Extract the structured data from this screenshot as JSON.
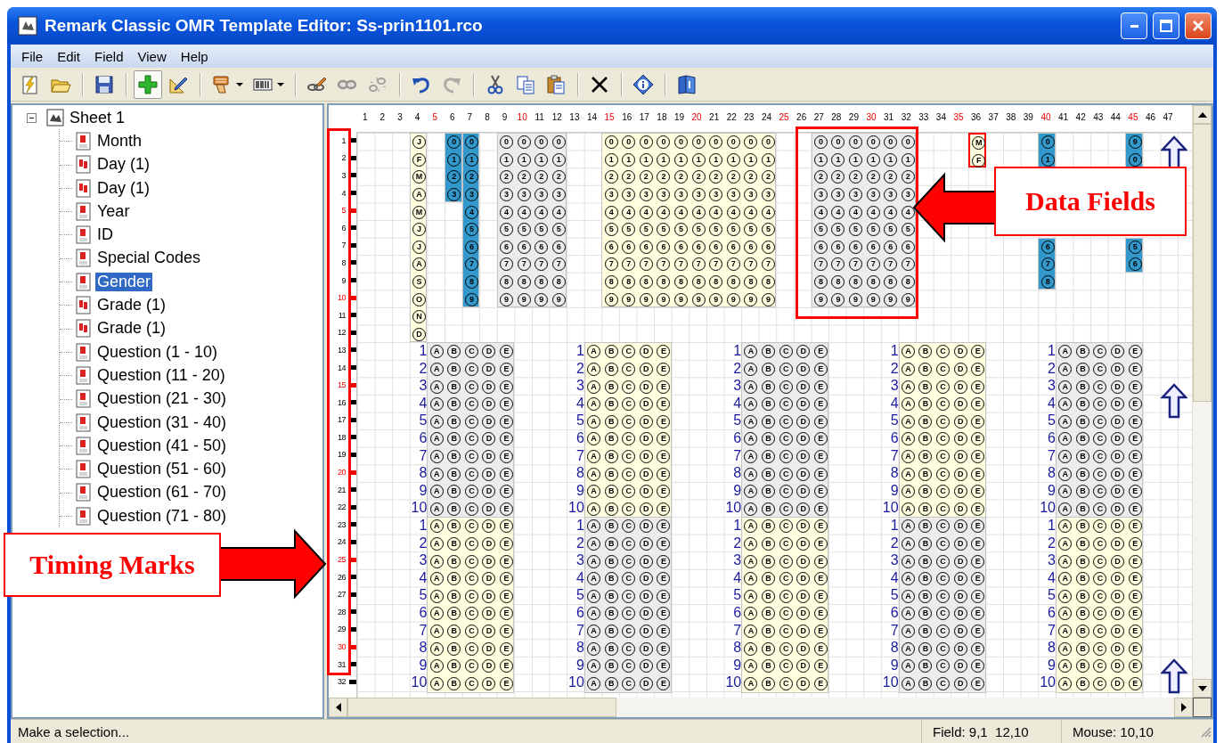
{
  "window": {
    "title": "Remark Classic OMR Template Editor: Ss-prin1101.rco"
  },
  "menu": [
    {
      "label": "File"
    },
    {
      "label": "Edit"
    },
    {
      "label": "Field"
    },
    {
      "label": "View"
    },
    {
      "label": "Help"
    }
  ],
  "toolbar": [
    {
      "kind": "new",
      "pressed": false,
      "disabled": false,
      "dropdown": false
    },
    {
      "kind": "open",
      "pressed": false,
      "disabled": false,
      "dropdown": false
    },
    {
      "kind": "separator"
    },
    {
      "kind": "save",
      "pressed": false,
      "disabled": false,
      "dropdown": false
    },
    {
      "kind": "separator"
    },
    {
      "kind": "add",
      "pressed": true,
      "disabled": false,
      "dropdown": false
    },
    {
      "kind": "edit",
      "pressed": false,
      "disabled": false,
      "dropdown": false
    },
    {
      "kind": "separator"
    },
    {
      "kind": "brush",
      "pressed": false,
      "disabled": false,
      "dropdown": true
    },
    {
      "kind": "barcode",
      "pressed": false,
      "disabled": false,
      "dropdown": true
    },
    {
      "kind": "separator"
    },
    {
      "kind": "linkedit",
      "pressed": false,
      "disabled": false,
      "dropdown": false
    },
    {
      "kind": "link",
      "pressed": false,
      "disabled": true,
      "dropdown": false
    },
    {
      "kind": "unlink",
      "pressed": false,
      "disabled": true,
      "dropdown": false
    },
    {
      "kind": "separator"
    },
    {
      "kind": "undo",
      "pressed": false,
      "disabled": false,
      "dropdown": false
    },
    {
      "kind": "redo",
      "pressed": false,
      "disabled": true,
      "dropdown": false
    },
    {
      "kind": "separator"
    },
    {
      "kind": "cut",
      "pressed": false,
      "disabled": false,
      "dropdown": false
    },
    {
      "kind": "copy",
      "pressed": false,
      "disabled": false,
      "dropdown": false
    },
    {
      "kind": "paste",
      "pressed": false,
      "disabled": false,
      "dropdown": false
    },
    {
      "kind": "separator"
    },
    {
      "kind": "delete",
      "pressed": false,
      "disabled": false,
      "dropdown": false
    },
    {
      "kind": "separator"
    },
    {
      "kind": "info",
      "pressed": false,
      "disabled": false,
      "dropdown": false
    },
    {
      "kind": "separator"
    },
    {
      "kind": "book",
      "pressed": false,
      "disabled": false,
      "dropdown": false
    }
  ],
  "tree": {
    "label": "Sheet 1",
    "expanded": true,
    "children": [
      {
        "label": "Month",
        "kind": "single",
        "selected": false
      },
      {
        "label": "Day (1)",
        "kind": "multi",
        "selected": false
      },
      {
        "label": "Day (1)",
        "kind": "multi",
        "selected": false
      },
      {
        "label": "Year",
        "kind": "single",
        "selected": false
      },
      {
        "label": "ID",
        "kind": "single",
        "selected": false
      },
      {
        "label": "Special Codes",
        "kind": "single",
        "selected": false
      },
      {
        "label": "Gender",
        "kind": "single",
        "selected": true
      },
      {
        "label": "Grade (1)",
        "kind": "multi",
        "selected": false
      },
      {
        "label": "Grade (1)",
        "kind": "multi",
        "selected": false
      },
      {
        "label": "Question (1 - 10)",
        "kind": "single",
        "selected": false
      },
      {
        "label": "Question (11 - 20)",
        "kind": "single",
        "selected": false
      },
      {
        "label": "Question (21 - 30)",
        "kind": "single",
        "selected": false
      },
      {
        "label": "Question (31 - 40)",
        "kind": "single",
        "selected": false
      },
      {
        "label": "Question (41 - 50)",
        "kind": "single",
        "selected": false
      },
      {
        "label": "Question (51 - 60)",
        "kind": "single",
        "selected": false
      },
      {
        "label": "Question (61 - 70)",
        "kind": "single",
        "selected": false
      },
      {
        "label": "Question (71 - 80)",
        "kind": "single",
        "selected": false
      }
    ]
  },
  "canvas": {
    "column_headers": [
      {
        "label": "1",
        "accent": false
      },
      {
        "label": "2",
        "accent": false
      },
      {
        "label": "3",
        "accent": false
      },
      {
        "label": "4",
        "accent": false
      },
      {
        "label": "5",
        "accent": true
      },
      {
        "label": "6",
        "accent": false
      },
      {
        "label": "7",
        "accent": false
      },
      {
        "label": "8",
        "accent": false
      },
      {
        "label": "9",
        "accent": false
      },
      {
        "label": "10",
        "accent": true
      },
      {
        "label": "11",
        "accent": false
      },
      {
        "label": "12",
        "accent": false
      },
      {
        "label": "13",
        "accent": false
      },
      {
        "label": "14",
        "accent": false
      },
      {
        "label": "15",
        "accent": true
      },
      {
        "label": "16",
        "accent": false
      },
      {
        "label": "17",
        "accent": false
      },
      {
        "label": "18",
        "accent": false
      },
      {
        "label": "19",
        "accent": false
      },
      {
        "label": "20",
        "accent": true
      },
      {
        "label": "21",
        "accent": false
      },
      {
        "label": "22",
        "accent": false
      },
      {
        "label": "23",
        "accent": false
      },
      {
        "label": "24",
        "accent": false
      },
      {
        "label": "25",
        "accent": true
      },
      {
        "label": "26",
        "accent": false
      },
      {
        "label": "27",
        "accent": false
      },
      {
        "label": "28",
        "accent": false
      },
      {
        "label": "29",
        "accent": false
      },
      {
        "label": "30",
        "accent": true
      },
      {
        "label": "31",
        "accent": false
      },
      {
        "label": "32",
        "accent": false
      },
      {
        "label": "33",
        "accent": false
      },
      {
        "label": "34",
        "accent": false
      },
      {
        "label": "35",
        "accent": true
      },
      {
        "label": "36",
        "accent": false
      },
      {
        "label": "37",
        "accent": false
      },
      {
        "label": "38",
        "accent": false
      },
      {
        "label": "39",
        "accent": false
      },
      {
        "label": "40",
        "accent": true
      },
      {
        "label": "41",
        "accent": false
      },
      {
        "label": "42",
        "accent": false
      },
      {
        "label": "43",
        "accent": false
      },
      {
        "label": "44",
        "accent": false
      },
      {
        "label": "45",
        "accent": true
      },
      {
        "label": "46",
        "accent": false
      },
      {
        "label": "47",
        "accent": false
      }
    ],
    "row_headers": [
      {
        "label": "1",
        "accent": false
      },
      {
        "label": "2",
        "accent": false
      },
      {
        "label": "3",
        "accent": false
      },
      {
        "label": "4",
        "accent": false
      },
      {
        "label": "5",
        "accent": true
      },
      {
        "label": "6",
        "accent": false
      },
      {
        "label": "7",
        "accent": false
      },
      {
        "label": "8",
        "accent": false
      },
      {
        "label": "9",
        "accent": false
      },
      {
        "label": "10",
        "accent": true
      },
      {
        "label": "11",
        "accent": false
      },
      {
        "label": "12",
        "accent": false
      },
      {
        "label": "13",
        "accent": false
      },
      {
        "label": "14",
        "accent": false
      },
      {
        "label": "15",
        "accent": true
      },
      {
        "label": "16",
        "accent": false
      },
      {
        "label": "17",
        "accent": false
      },
      {
        "label": "18",
        "accent": false
      },
      {
        "label": "19",
        "accent": false
      },
      {
        "label": "20",
        "accent": true
      },
      {
        "label": "21",
        "accent": false
      },
      {
        "label": "22",
        "accent": false
      },
      {
        "label": "23",
        "accent": false
      },
      {
        "label": "24",
        "accent": false
      },
      {
        "label": "25",
        "accent": true
      },
      {
        "label": "26",
        "accent": false
      },
      {
        "label": "27",
        "accent": false
      },
      {
        "label": "28",
        "accent": false
      },
      {
        "label": "29",
        "accent": false
      },
      {
        "label": "30",
        "accent": true
      },
      {
        "label": "31",
        "accent": false
      },
      {
        "label": "32",
        "accent": false
      }
    ],
    "fields": [
      {
        "color": "#ffffe0",
        "selected": false,
        "rows": [
          [
            "J"
          ],
          [
            "F"
          ],
          [
            "M"
          ],
          [
            "A"
          ],
          [
            "M"
          ],
          [
            "J"
          ],
          [
            "J"
          ],
          [
            "A"
          ],
          [
            "S"
          ],
          [
            "O"
          ],
          [
            "N"
          ],
          [
            "D"
          ]
        ]
      },
      {
        "color": "#3399cc",
        "selected": false,
        "rows": [
          [
            "0"
          ],
          [
            "1"
          ],
          [
            "2"
          ],
          [
            "3"
          ]
        ]
      },
      {
        "color": "#3399cc",
        "selected": false,
        "rows": [
          [
            "0"
          ],
          [
            "1"
          ],
          [
            "2"
          ],
          [
            "3"
          ],
          [
            "4"
          ],
          [
            "5"
          ],
          [
            "6"
          ],
          [
            "7"
          ],
          [
            "8"
          ],
          [
            "9"
          ]
        ]
      },
      {
        "color": "#ececec",
        "selected": false,
        "rows": [
          [
            "0",
            "0",
            "0",
            "0"
          ],
          [
            "1",
            "1",
            "1",
            "1"
          ],
          [
            "2",
            "2",
            "2",
            "2"
          ],
          [
            "3",
            "3",
            "3",
            "3"
          ],
          [
            "4",
            "4",
            "4",
            "4"
          ],
          [
            "5",
            "5",
            "5",
            "5"
          ],
          [
            "6",
            "6",
            "6",
            "6"
          ],
          [
            "7",
            "7",
            "7",
            "7"
          ],
          [
            "8",
            "8",
            "8",
            "8"
          ],
          [
            "9",
            "9",
            "9",
            "9"
          ]
        ]
      },
      {
        "color": "#ffffe0",
        "selected": false,
        "rows": [
          [
            "0",
            "0",
            "0",
            "0",
            "0",
            "0",
            "0",
            "0",
            "0",
            "0"
          ],
          [
            "1",
            "1",
            "1",
            "1",
            "1",
            "1",
            "1",
            "1",
            "1",
            "1"
          ],
          [
            "2",
            "2",
            "2",
            "2",
            "2",
            "2",
            "2",
            "2",
            "2",
            "2"
          ],
          [
            "3",
            "3",
            "3",
            "3",
            "3",
            "3",
            "3",
            "3",
            "3",
            "3"
          ],
          [
            "4",
            "4",
            "4",
            "4",
            "4",
            "4",
            "4",
            "4",
            "4",
            "4"
          ],
          [
            "5",
            "5",
            "5",
            "5",
            "5",
            "5",
            "5",
            "5",
            "5",
            "5"
          ],
          [
            "6",
            "6",
            "6",
            "6",
            "6",
            "6",
            "6",
            "6",
            "6",
            "6"
          ],
          [
            "7",
            "7",
            "7",
            "7",
            "7",
            "7",
            "7",
            "7",
            "7",
            "7"
          ],
          [
            "8",
            "8",
            "8",
            "8",
            "8",
            "8",
            "8",
            "8",
            "8",
            "8"
          ],
          [
            "9",
            "9",
            "9",
            "9",
            "9",
            "9",
            "9",
            "9",
            "9",
            "9"
          ]
        ]
      },
      {
        "color": "#ececec",
        "selected": false,
        "rows": [
          [
            "0",
            "0",
            "0",
            "0",
            "0",
            "0"
          ],
          [
            "1",
            "1",
            "1",
            "1",
            "1",
            "1"
          ],
          [
            "2",
            "2",
            "2",
            "2",
            "2",
            "2"
          ],
          [
            "3",
            "3",
            "3",
            "3",
            "3",
            "3"
          ],
          [
            "4",
            "4",
            "4",
            "4",
            "4",
            "4"
          ],
          [
            "5",
            "5",
            "5",
            "5",
            "5",
            "5"
          ],
          [
            "6",
            "6",
            "6",
            "6",
            "6",
            "6"
          ],
          [
            "7",
            "7",
            "7",
            "7",
            "7",
            "7"
          ],
          [
            "8",
            "8",
            "8",
            "8",
            "8",
            "8"
          ],
          [
            "9",
            "9",
            "9",
            "9",
            "9",
            "9"
          ]
        ]
      },
      {
        "color": "#ffffe0",
        "selected": true,
        "rows": [
          [
            "M"
          ],
          [
            "F"
          ]
        ]
      },
      {
        "color": "#3399cc",
        "selected": false,
        "rows": [
          [
            "0"
          ],
          [
            "1"
          ]
        ]
      },
      {
        "color": "#3399cc",
        "selected": false,
        "rows": [
          [
            "6"
          ],
          [
            "7"
          ],
          [
            "8"
          ]
        ]
      },
      {
        "color": "#3399cc",
        "selected": false,
        "rows": [
          [
            "9"
          ],
          [
            "0"
          ]
        ]
      },
      {
        "color": "#3399cc",
        "selected": false,
        "rows": [
          [
            "5"
          ],
          [
            "6"
          ]
        ]
      }
    ],
    "question_blocks": [
      {
        "color": "#ececec",
        "items": [
          {
            "number": "1",
            "choices": [
              "A",
              "B",
              "C",
              "D",
              "E"
            ]
          },
          {
            "number": "2",
            "choices": [
              "A",
              "B",
              "C",
              "D",
              "E"
            ]
          },
          {
            "number": "3",
            "choices": [
              "A",
              "B",
              "C",
              "D",
              "E"
            ]
          },
          {
            "number": "4",
            "choices": [
              "A",
              "B",
              "C",
              "D",
              "E"
            ]
          },
          {
            "number": "5",
            "choices": [
              "A",
              "B",
              "C",
              "D",
              "E"
            ]
          },
          {
            "number": "6",
            "choices": [
              "A",
              "B",
              "C",
              "D",
              "E"
            ]
          },
          {
            "number": "7",
            "choices": [
              "A",
              "B",
              "C",
              "D",
              "E"
            ]
          },
          {
            "number": "8",
            "choices": [
              "A",
              "B",
              "C",
              "D",
              "E"
            ]
          },
          {
            "number": "9",
            "choices": [
              "A",
              "B",
              "C",
              "D",
              "E"
            ]
          },
          {
            "number": "10",
            "choices": [
              "A",
              "B",
              "C",
              "D",
              "E"
            ]
          }
        ]
      },
      {
        "color": "#ffffe0",
        "items": [
          {
            "number": "1",
            "choices": [
              "A",
              "B",
              "C",
              "D",
              "E"
            ]
          },
          {
            "number": "2",
            "choices": [
              "A",
              "B",
              "C",
              "D",
              "E"
            ]
          },
          {
            "number": "3",
            "choices": [
              "A",
              "B",
              "C",
              "D",
              "E"
            ]
          },
          {
            "number": "4",
            "choices": [
              "A",
              "B",
              "C",
              "D",
              "E"
            ]
          },
          {
            "number": "5",
            "choices": [
              "A",
              "B",
              "C",
              "D",
              "E"
            ]
          },
          {
            "number": "6",
            "choices": [
              "A",
              "B",
              "C",
              "D",
              "E"
            ]
          },
          {
            "number": "7",
            "choices": [
              "A",
              "B",
              "C",
              "D",
              "E"
            ]
          },
          {
            "number": "8",
            "choices": [
              "A",
              "B",
              "C",
              "D",
              "E"
            ]
          },
          {
            "number": "9",
            "choices": [
              "A",
              "B",
              "C",
              "D",
              "E"
            ]
          },
          {
            "number": "10",
            "choices": [
              "A",
              "B",
              "C",
              "D",
              "E"
            ]
          }
        ]
      },
      {
        "color": "#ececec",
        "items": [
          {
            "number": "1",
            "choices": [
              "A",
              "B",
              "C",
              "D",
              "E"
            ]
          },
          {
            "number": "2",
            "choices": [
              "A",
              "B",
              "C",
              "D",
              "E"
            ]
          },
          {
            "number": "3",
            "choices": [
              "A",
              "B",
              "C",
              "D",
              "E"
            ]
          },
          {
            "number": "4",
            "choices": [
              "A",
              "B",
              "C",
              "D",
              "E"
            ]
          },
          {
            "number": "5",
            "choices": [
              "A",
              "B",
              "C",
              "D",
              "E"
            ]
          },
          {
            "number": "6",
            "choices": [
              "A",
              "B",
              "C",
              "D",
              "E"
            ]
          },
          {
            "number": "7",
            "choices": [
              "A",
              "B",
              "C",
              "D",
              "E"
            ]
          },
          {
            "number": "8",
            "choices": [
              "A",
              "B",
              "C",
              "D",
              "E"
            ]
          },
          {
            "number": "9",
            "choices": [
              "A",
              "B",
              "C",
              "D",
              "E"
            ]
          },
          {
            "number": "10",
            "choices": [
              "A",
              "B",
              "C",
              "D",
              "E"
            ]
          }
        ]
      },
      {
        "color": "#ffffe0",
        "items": [
          {
            "number": "1",
            "choices": [
              "A",
              "B",
              "C",
              "D",
              "E"
            ]
          },
          {
            "number": "2",
            "choices": [
              "A",
              "B",
              "C",
              "D",
              "E"
            ]
          },
          {
            "number": "3",
            "choices": [
              "A",
              "B",
              "C",
              "D",
              "E"
            ]
          },
          {
            "number": "4",
            "choices": [
              "A",
              "B",
              "C",
              "D",
              "E"
            ]
          },
          {
            "number": "5",
            "choices": [
              "A",
              "B",
              "C",
              "D",
              "E"
            ]
          },
          {
            "number": "6",
            "choices": [
              "A",
              "B",
              "C",
              "D",
              "E"
            ]
          },
          {
            "number": "7",
            "choices": [
              "A",
              "B",
              "C",
              "D",
              "E"
            ]
          },
          {
            "number": "8",
            "choices": [
              "A",
              "B",
              "C",
              "D",
              "E"
            ]
          },
          {
            "number": "9",
            "choices": [
              "A",
              "B",
              "C",
              "D",
              "E"
            ]
          },
          {
            "number": "10",
            "choices": [
              "A",
              "B",
              "C",
              "D",
              "E"
            ]
          }
        ]
      },
      {
        "color": "#ececec",
        "items": [
          {
            "number": "1",
            "choices": [
              "A",
              "B",
              "C",
              "D",
              "E"
            ]
          },
          {
            "number": "2",
            "choices": [
              "A",
              "B",
              "C",
              "D",
              "E"
            ]
          },
          {
            "number": "3",
            "choices": [
              "A",
              "B",
              "C",
              "D",
              "E"
            ]
          },
          {
            "number": "4",
            "choices": [
              "A",
              "B",
              "C",
              "D",
              "E"
            ]
          },
          {
            "number": "5",
            "choices": [
              "A",
              "B",
              "C",
              "D",
              "E"
            ]
          },
          {
            "number": "6",
            "choices": [
              "A",
              "B",
              "C",
              "D",
              "E"
            ]
          },
          {
            "number": "7",
            "choices": [
              "A",
              "B",
              "C",
              "D",
              "E"
            ]
          },
          {
            "number": "8",
            "choices": [
              "A",
              "B",
              "C",
              "D",
              "E"
            ]
          },
          {
            "number": "9",
            "choices": [
              "A",
              "B",
              "C",
              "D",
              "E"
            ]
          },
          {
            "number": "10",
            "choices": [
              "A",
              "B",
              "C",
              "D",
              "E"
            ]
          }
        ]
      },
      {
        "color": "#ffffe0",
        "items": [
          {
            "number": "1",
            "choices": [
              "A",
              "B",
              "C",
              "D",
              "E"
            ]
          },
          {
            "number": "2",
            "choices": [
              "A",
              "B",
              "C",
              "D",
              "E"
            ]
          },
          {
            "number": "3",
            "choices": [
              "A",
              "B",
              "C",
              "D",
              "E"
            ]
          },
          {
            "number": "4",
            "choices": [
              "A",
              "B",
              "C",
              "D",
              "E"
            ]
          },
          {
            "number": "5",
            "choices": [
              "A",
              "B",
              "C",
              "D",
              "E"
            ]
          },
          {
            "number": "6",
            "choices": [
              "A",
              "B",
              "C",
              "D",
              "E"
            ]
          },
          {
            "number": "7",
            "choices": [
              "A",
              "B",
              "C",
              "D",
              "E"
            ]
          },
          {
            "number": "8",
            "choices": [
              "A",
              "B",
              "C",
              "D",
              "E"
            ]
          },
          {
            "number": "9",
            "choices": [
              "A",
              "B",
              "C",
              "D",
              "E"
            ]
          },
          {
            "number": "10",
            "choices": [
              "A",
              "B",
              "C",
              "D",
              "E"
            ]
          }
        ]
      },
      {
        "color": "#ececec",
        "items": [
          {
            "number": "1",
            "choices": [
              "A",
              "B",
              "C",
              "D",
              "E"
            ]
          },
          {
            "number": "2",
            "choices": [
              "A",
              "B",
              "C",
              "D",
              "E"
            ]
          },
          {
            "number": "3",
            "choices": [
              "A",
              "B",
              "C",
              "D",
              "E"
            ]
          },
          {
            "number": "4",
            "choices": [
              "A",
              "B",
              "C",
              "D",
              "E"
            ]
          },
          {
            "number": "5",
            "choices": [
              "A",
              "B",
              "C",
              "D",
              "E"
            ]
          },
          {
            "number": "6",
            "choices": [
              "A",
              "B",
              "C",
              "D",
              "E"
            ]
          },
          {
            "number": "7",
            "choices": [
              "A",
              "B",
              "C",
              "D",
              "E"
            ]
          },
          {
            "number": "8",
            "choices": [
              "A",
              "B",
              "C",
              "D",
              "E"
            ]
          },
          {
            "number": "9",
            "choices": [
              "A",
              "B",
              "C",
              "D",
              "E"
            ]
          },
          {
            "number": "10",
            "choices": [
              "A",
              "B",
              "C",
              "D",
              "E"
            ]
          }
        ]
      },
      {
        "color": "#ffffe0",
        "items": [
          {
            "number": "1",
            "choices": [
              "A",
              "B",
              "C",
              "D",
              "E"
            ]
          },
          {
            "number": "2",
            "choices": [
              "A",
              "B",
              "C",
              "D",
              "E"
            ]
          },
          {
            "number": "3",
            "choices": [
              "A",
              "B",
              "C",
              "D",
              "E"
            ]
          },
          {
            "number": "4",
            "choices": [
              "A",
              "B",
              "C",
              "D",
              "E"
            ]
          },
          {
            "number": "5",
            "choices": [
              "A",
              "B",
              "C",
              "D",
              "E"
            ]
          },
          {
            "number": "6",
            "choices": [
              "A",
              "B",
              "C",
              "D",
              "E"
            ]
          },
          {
            "number": "7",
            "choices": [
              "A",
              "B",
              "C",
              "D",
              "E"
            ]
          },
          {
            "number": "8",
            "choices": [
              "A",
              "B",
              "C",
              "D",
              "E"
            ]
          },
          {
            "number": "9",
            "choices": [
              "A",
              "B",
              "C",
              "D",
              "E"
            ]
          },
          {
            "number": "10",
            "choices": [
              "A",
              "B",
              "C",
              "D",
              "E"
            ]
          }
        ]
      },
      {
        "color": "#ececec",
        "items": [
          {
            "number": "1",
            "choices": [
              "A",
              "B",
              "C",
              "D",
              "E"
            ]
          },
          {
            "number": "2",
            "choices": [
              "A",
              "B",
              "C",
              "D",
              "E"
            ]
          },
          {
            "number": "3",
            "choices": [
              "A",
              "B",
              "C",
              "D",
              "E"
            ]
          },
          {
            "number": "4",
            "choices": [
              "A",
              "B",
              "C",
              "D",
              "E"
            ]
          },
          {
            "number": "5",
            "choices": [
              "A",
              "B",
              "C",
              "D",
              "E"
            ]
          },
          {
            "number": "6",
            "choices": [
              "A",
              "B",
              "C",
              "D",
              "E"
            ]
          },
          {
            "number": "7",
            "choices": [
              "A",
              "B",
              "C",
              "D",
              "E"
            ]
          },
          {
            "number": "8",
            "choices": [
              "A",
              "B",
              "C",
              "D",
              "E"
            ]
          },
          {
            "number": "9",
            "choices": [
              "A",
              "B",
              "C",
              "D",
              "E"
            ]
          },
          {
            "number": "10",
            "choices": [
              "A",
              "B",
              "C",
              "D",
              "E"
            ]
          }
        ]
      },
      {
        "color": "#ffffe0",
        "items": [
          {
            "number": "1",
            "choices": [
              "A",
              "B",
              "C",
              "D",
              "E"
            ]
          },
          {
            "number": "2",
            "choices": [
              "A",
              "B",
              "C",
              "D",
              "E"
            ]
          },
          {
            "number": "3",
            "choices": [
              "A",
              "B",
              "C",
              "D",
              "E"
            ]
          },
          {
            "number": "4",
            "choices": [
              "A",
              "B",
              "C",
              "D",
              "E"
            ]
          },
          {
            "number": "5",
            "choices": [
              "A",
              "B",
              "C",
              "D",
              "E"
            ]
          },
          {
            "number": "6",
            "choices": [
              "A",
              "B",
              "C",
              "D",
              "E"
            ]
          },
          {
            "number": "7",
            "choices": [
              "A",
              "B",
              "C",
              "D",
              "E"
            ]
          },
          {
            "number": "8",
            "choices": [
              "A",
              "B",
              "C",
              "D",
              "E"
            ]
          },
          {
            "number": "9",
            "choices": [
              "A",
              "B",
              "C",
              "D",
              "E"
            ]
          },
          {
            "number": "10",
            "choices": [
              "A",
              "B",
              "C",
              "D",
              "E"
            ]
          }
        ]
      }
    ]
  },
  "annotations": [
    {
      "kind": "left-callout",
      "text": "Data Fields"
    },
    {
      "kind": "right-callout",
      "text": "Timing Marks"
    }
  ],
  "status_bar": {
    "message": "Make a selection...",
    "field": "Field: 9,1  12,10",
    "mouse": "Mouse: 10,10"
  }
}
